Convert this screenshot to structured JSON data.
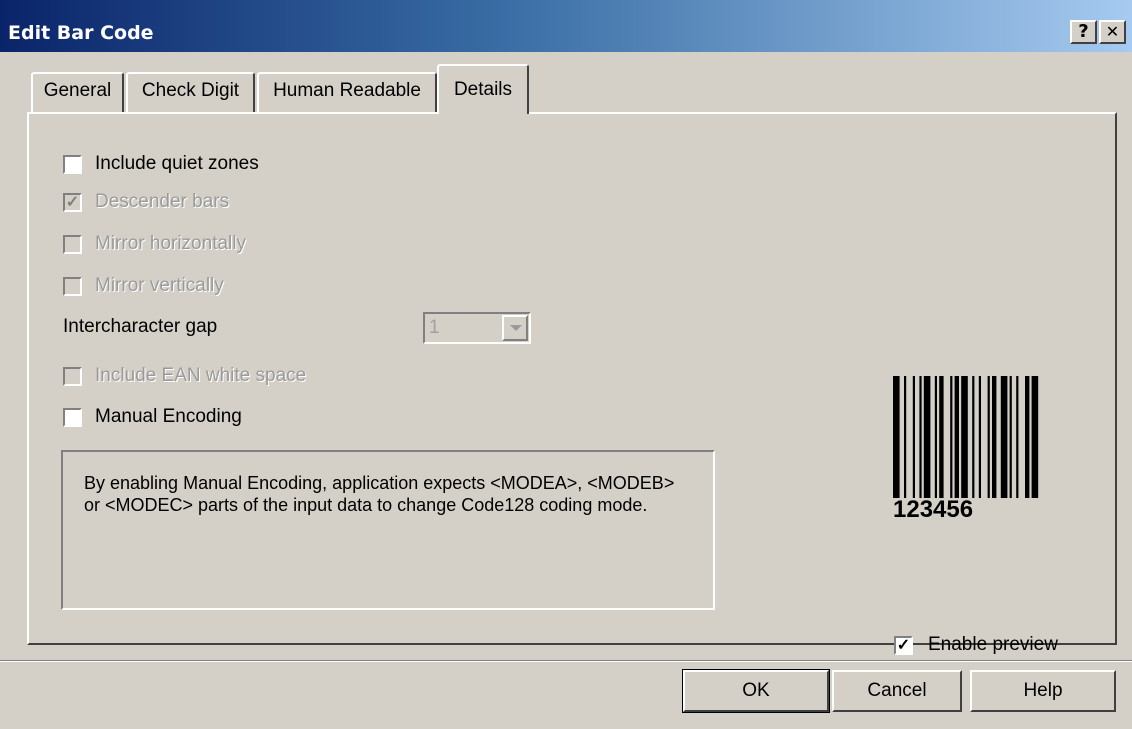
{
  "window": {
    "title": "Edit Bar Code",
    "help_button": "?",
    "close_button": "✕"
  },
  "tabs": [
    {
      "label": "General"
    },
    {
      "label": "Check Digit"
    },
    {
      "label": "Human Readable"
    },
    {
      "label": "Details",
      "active": true
    }
  ],
  "options": {
    "include_quiet_zones": {
      "label": "Include quiet zones",
      "checked": false,
      "enabled": true
    },
    "descender_bars": {
      "label": "Descender bars",
      "checked": true,
      "enabled": false
    },
    "mirror_horizontally": {
      "label": "Mirror horizontally",
      "checked": false,
      "enabled": false
    },
    "mirror_vertically": {
      "label": "Mirror vertically",
      "checked": false,
      "enabled": false
    },
    "intercharacter_gap": {
      "label": "Intercharacter gap",
      "value": "1",
      "enabled": false
    },
    "include_ean_white_space": {
      "label": "Include EAN white space",
      "checked": false,
      "enabled": false
    },
    "manual_encoding": {
      "label": "Manual Encoding",
      "checked": false,
      "enabled": true
    }
  },
  "info": {
    "text": "By enabling Manual Encoding, application expects <MODEA>, <MODEB> or <MODEC> parts of the input data to change Code128 coding mode."
  },
  "preview": {
    "barcode_text": "123456",
    "enable_preview": {
      "label": "Enable preview",
      "checked": true
    }
  },
  "buttons": {
    "ok": "OK",
    "cancel": "Cancel",
    "help": "Help"
  }
}
